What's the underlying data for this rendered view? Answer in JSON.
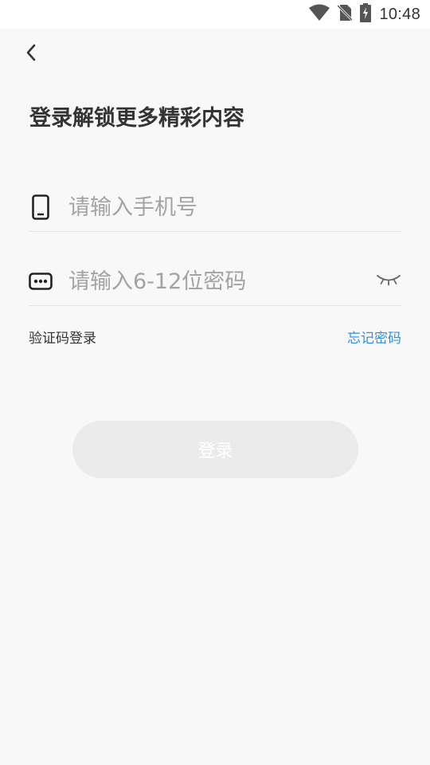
{
  "status_bar": {
    "time": "10:48",
    "icons": [
      "wifi-icon",
      "no-sim-icon",
      "battery-charging-icon"
    ]
  },
  "nav": {
    "back_icon": "chevron-left-icon"
  },
  "title": "登录解锁更多精彩内容",
  "form": {
    "phone": {
      "icon": "phone-icon",
      "value": "",
      "placeholder": "请输入手机号"
    },
    "password": {
      "icon": "password-dots-icon",
      "value": "",
      "placeholder": "请输入6-12位密码",
      "toggle_icon": "eye-closed-icon"
    },
    "sms_login_label": "验证码登录",
    "forgot_password_label": "忘记密码",
    "login_button_label": "登录"
  },
  "colors": {
    "background": "#f8f8f8",
    "link": "#2f8fe6",
    "button_disabled": "#ebebeb",
    "placeholder": "#a3a3a3"
  }
}
